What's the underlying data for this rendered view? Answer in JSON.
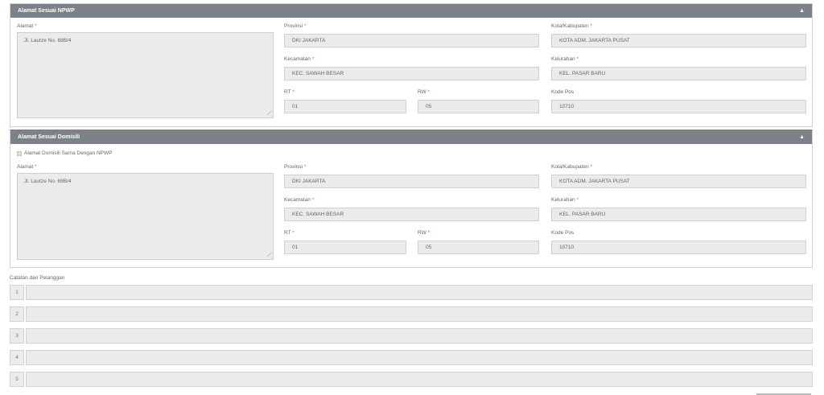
{
  "npwp_section": {
    "title": "Alamat Sesuai NPWP",
    "alamat_label": "Alamat",
    "alamat_value": "Jl. Lautze No. 68B/4",
    "provinsi_label": "Provinsi",
    "provinsi_value": "DKI JAKARTA",
    "kota_label": "Kota/Kabupaten",
    "kota_value": "KOTA ADM. JAKARTA PUSAT",
    "kecamatan_label": "Kecamatan",
    "kecamatan_value": "KEC. SAWAH BESAR",
    "kelurahan_label": "Kelurahan",
    "kelurahan_value": "KEL. PASAR BARU",
    "rt_label": "RT",
    "rt_value": "01",
    "rw_label": "RW",
    "rw_value": "05",
    "kodepos_label": "Kode Pos",
    "kodepos_value": "10710"
  },
  "domisili_section": {
    "title": "Alamat Sesuai Domisili",
    "same_as_npwp_label": "Alamat Domisili Sama Dengan NPWP",
    "alamat_label": "Alamat",
    "alamat_value": "Jl. Lautze No. 68B/4",
    "provinsi_label": "Provinsi",
    "provinsi_value": "DKI JAKARTA",
    "kota_label": "Kota/Kabupaten",
    "kota_value": "KOTA ADM. JAKARTA PUSAT",
    "kecamatan_label": "Kecamatan",
    "kecamatan_value": "KEC. SAWAH BESAR",
    "kelurahan_label": "Kelurahan",
    "kelurahan_value": "KEL. PASAR BARU",
    "rt_label": "RT",
    "rt_value": "01",
    "rw_label": "RW",
    "rw_value": "05",
    "kodepos_label": "Kode Pos",
    "kodepos_value": "10710"
  },
  "required_mark": "*",
  "collapse_icon": "caret-up-icon",
  "notes": {
    "label": "Catatan dari Pelanggan",
    "rows": [
      {
        "num": "1",
        "value": ""
      },
      {
        "num": "2",
        "value": ""
      },
      {
        "num": "3",
        "value": ""
      },
      {
        "num": "4",
        "value": ""
      },
      {
        "num": "5",
        "value": ""
      }
    ]
  }
}
